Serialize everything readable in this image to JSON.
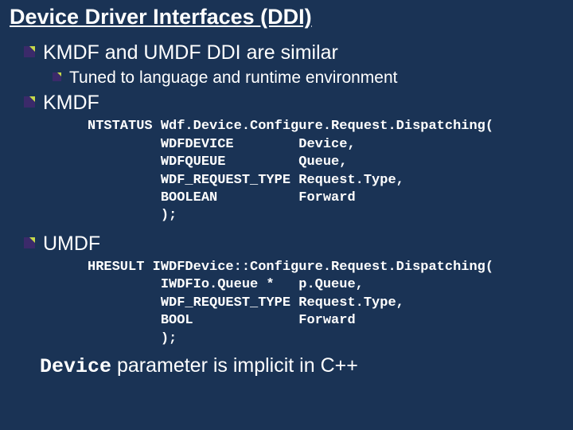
{
  "title": "Device Driver Interfaces (DDI)",
  "bullets": {
    "similar": "KMDF and UMDF DDI are similar",
    "tuned": "Tuned to language and runtime environment",
    "kmdf": "KMDF",
    "umdf": "UMDF"
  },
  "code": {
    "kmdf": "NTSTATUS Wdf.Device.Configure.Request.Dispatching(\n         WDFDEVICE        Device,\n         WDFQUEUE         Queue,\n         WDF_REQUEST_TYPE Request.Type,\n         BOOLEAN          Forward\n         );",
    "umdf": "HRESULT IWDFDevice::Configure.Request.Dispatching(\n         IWDFIo.Queue *   p.Queue,\n         WDF_REQUEST_TYPE Request.Type,\n         BOOL             Forward\n         );"
  },
  "final": {
    "mono": "Device",
    "rest": " parameter is implicit in C++"
  }
}
